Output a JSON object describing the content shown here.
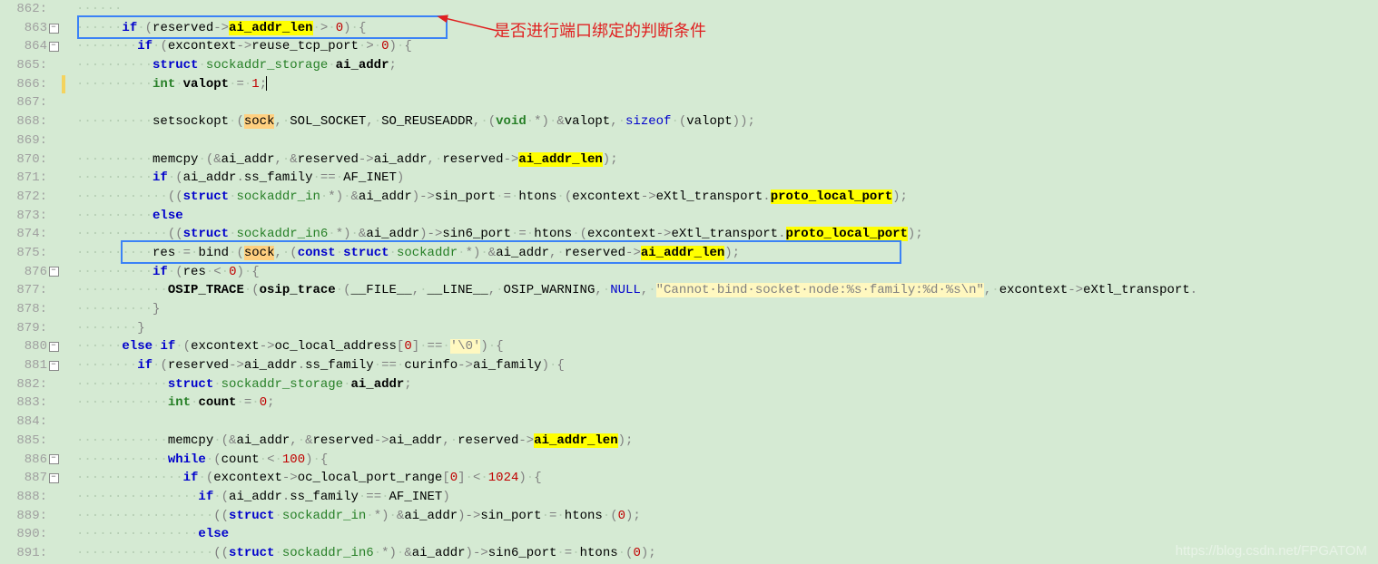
{
  "annotation": "是否进行端口绑定的判断条件",
  "watermark": "https://blog.csdn.net/FPGATOM",
  "lines": [
    {
      "n": "862:",
      "fold": false,
      "chg": false,
      "html": "<span class='ws'>······</span>"
    },
    {
      "n": "863",
      "fold": true,
      "chg": false,
      "html": "<span class='ws'>······</span><span class='kw'>if</span><span class='ws'>·</span><span class='op'>(</span>reserved<span class='op'>-&gt;</span><span class='id hl-y'>ai_addr_len</span><span class='ws'>·</span><span class='op'>&gt;</span><span class='ws'>·</span><span class='num'>0</span><span class='op'>)</span><span class='ws'>·</span><span class='op'>{</span>"
    },
    {
      "n": "864",
      "fold": true,
      "chg": false,
      "html": "<span class='ws'>········</span><span class='kw'>if</span><span class='ws'>·</span><span class='op'>(</span>excontext<span class='op'>-&gt;</span>reuse_tcp_port<span class='ws'>·</span><span class='op'>&gt;</span><span class='ws'>·</span><span class='num'>0</span><span class='op'>)</span><span class='ws'>·</span><span class='op'>{</span>"
    },
    {
      "n": "865:",
      "fold": false,
      "chg": false,
      "html": "<span class='ws'>··········</span><span class='kw'>struct</span><span class='ws'>·</span><span class='type-nb'>sockaddr_storage</span><span class='ws'>·</span><span class='id'>ai_addr</span><span class='op'>;</span>"
    },
    {
      "n": "866:",
      "fold": false,
      "chg": true,
      "html": "<span class='ws'>··········</span><span class='type'>int</span><span class='ws'>·</span><span class='id'>valopt</span><span class='ws'>·</span><span class='op'>=</span><span class='ws'>·</span><span class='num'>1</span><span class='op'>;</span><span class='caret'></span>"
    },
    {
      "n": "867:",
      "fold": false,
      "chg": false,
      "html": ""
    },
    {
      "n": "868:",
      "fold": false,
      "chg": false,
      "html": "<span class='ws'>··········</span>setsockopt<span class='ws'>·</span><span class='op'>(</span><span class='hl-o'>sock</span><span class='op'>,</span><span class='ws'>·</span>SOL_SOCKET<span class='op'>,</span><span class='ws'>·</span>SO_REUSEADDR<span class='op'>,</span><span class='ws'>·</span><span class='op'>(</span><span class='type'>void</span><span class='ws'>·</span><span class='op'>*)</span><span class='ws'>·</span><span class='op'>&amp;</span>valopt<span class='op'>,</span><span class='ws'>·</span><span class='kw-nb'>sizeof</span><span class='ws'>·</span><span class='op'>(</span>valopt<span class='op'>));</span>"
    },
    {
      "n": "869:",
      "fold": false,
      "chg": false,
      "html": ""
    },
    {
      "n": "870:",
      "fold": false,
      "chg": false,
      "html": "<span class='ws'>··········</span>memcpy<span class='ws'>·</span><span class='op'>(&amp;</span>ai_addr<span class='op'>,</span><span class='ws'>·</span><span class='op'>&amp;</span>reserved<span class='op'>-&gt;</span>ai_addr<span class='op'>,</span><span class='ws'>·</span>reserved<span class='op'>-&gt;</span><span class='id hl-y'>ai_addr_len</span><span class='op'>);</span>"
    },
    {
      "n": "871:",
      "fold": false,
      "chg": false,
      "html": "<span class='ws'>··········</span><span class='kw'>if</span><span class='ws'>·</span><span class='op'>(</span>ai_addr<span class='op'>.</span>ss_family<span class='ws'>·</span><span class='op'>==</span><span class='ws'>·</span>AF_INET<span class='op'>)</span>"
    },
    {
      "n": "872:",
      "fold": false,
      "chg": false,
      "html": "<span class='ws'>············</span><span class='op'>((</span><span class='kw'>struct</span><span class='ws'>·</span><span class='type-nb'>sockaddr_in</span><span class='ws'>·</span><span class='op'>*)</span><span class='ws'>·</span><span class='op'>&amp;</span>ai_addr<span class='op'>)-&gt;</span>sin_port<span class='ws'>·</span><span class='op'>=</span><span class='ws'>·</span>htons<span class='ws'>·</span><span class='op'>(</span>excontext<span class='op'>-&gt;</span>eXtl_transport<span class='op'>.</span><span class='id hl-y'>proto_local_port</span><span class='op'>);</span>"
    },
    {
      "n": "873:",
      "fold": false,
      "chg": false,
      "html": "<span class='ws'>··········</span><span class='kw'>else</span>"
    },
    {
      "n": "874:",
      "fold": false,
      "chg": false,
      "html": "<span class='ws'>············</span><span class='op'>((</span><span class='kw'>struct</span><span class='ws'>·</span><span class='type-nb'>sockaddr_in6</span><span class='ws'>·</span><span class='op'>*)</span><span class='ws'>·</span><span class='op'>&amp;</span>ai_addr<span class='op'>)-&gt;</span>sin6_port<span class='ws'>·</span><span class='op'>=</span><span class='ws'>·</span>htons<span class='ws'>·</span><span class='op'>(</span>excontext<span class='op'>-&gt;</span>eXtl_transport<span class='op'>.</span><span class='id hl-y'>proto_local_port</span><span class='op'>);</span>"
    },
    {
      "n": "875:",
      "fold": false,
      "chg": false,
      "html": "<span class='ws'>··········</span>res<span class='ws'>·</span><span class='op'>=</span><span class='ws'>·</span>bind<span class='ws'>·</span><span class='op'>(</span><span class='hl-o'>sock</span><span class='op'>,</span><span class='ws'>·</span><span class='op'>(</span><span class='kw'>const</span><span class='ws'>·</span><span class='kw'>struct</span><span class='ws'>·</span><span class='type-nb'>sockaddr</span><span class='ws'>·</span><span class='op'>*)</span><span class='ws'>·</span><span class='op'>&amp;</span>ai_addr<span class='op'>,</span><span class='ws'>·</span>reserved<span class='op'>-&gt;</span><span class='id hl-y'>ai_addr_len</span><span class='op'>);</span>"
    },
    {
      "n": "876",
      "fold": true,
      "chg": false,
      "html": "<span class='ws'>··········</span><span class='kw'>if</span><span class='ws'>·</span><span class='op'>(</span>res<span class='ws'>·</span><span class='op'>&lt;</span><span class='ws'>·</span><span class='num'>0</span><span class='op'>)</span><span class='ws'>·</span><span class='op'>{</span>"
    },
    {
      "n": "877:",
      "fold": false,
      "chg": false,
      "html": "<span class='ws'>············</span><span class='id'>OSIP_TRACE</span><span class='ws'>·</span><span class='op'>(</span><span class='id'>osip_trace</span><span class='ws'>·</span><span class='op'>(</span>__FILE__<span class='op'>,</span><span class='ws'>·</span>__LINE__<span class='op'>,</span><span class='ws'>·</span>OSIP_WARNING<span class='op'>,</span><span class='ws'>·</span><span class='kw-nb'>NULL</span><span class='op'>,</span><span class='ws'>·</span><span class='str'>\"Cannot·bind·socket·node:%s·family:%d·%s\\n\"</span><span class='op'>,</span><span class='ws'>·</span>excontext<span class='op'>-&gt;</span>eXtl_transport<span class='op'>.</span>"
    },
    {
      "n": "878:",
      "fold": false,
      "chg": false,
      "html": "<span class='ws'>··········</span><span class='op'>}</span>"
    },
    {
      "n": "879:",
      "fold": false,
      "chg": false,
      "html": "<span class='ws'>········</span><span class='op'>}</span>"
    },
    {
      "n": "880",
      "fold": true,
      "chg": false,
      "html": "<span class='ws'>······</span><span class='kw'>else</span><span class='ws'>·</span><span class='kw'>if</span><span class='ws'>·</span><span class='op'>(</span>excontext<span class='op'>-&gt;</span>oc_local_address<span class='op'>[</span><span class='num'>0</span><span class='op'>]</span><span class='ws'>·</span><span class='op'>==</span><span class='ws'>·</span><span class='str'>'\\0'</span><span class='op'>)</span><span class='ws'>·</span><span class='op'>{</span>"
    },
    {
      "n": "881",
      "fold": true,
      "chg": false,
      "html": "<span class='ws'>········</span><span class='kw'>if</span><span class='ws'>·</span><span class='op'>(</span>reserved<span class='op'>-&gt;</span>ai_addr<span class='op'>.</span>ss_family<span class='ws'>·</span><span class='op'>==</span><span class='ws'>·</span>curinfo<span class='op'>-&gt;</span>ai_family<span class='op'>)</span><span class='ws'>·</span><span class='op'>{</span>"
    },
    {
      "n": "882:",
      "fold": false,
      "chg": false,
      "html": "<span class='ws'>············</span><span class='kw'>struct</span><span class='ws'>·</span><span class='type-nb'>sockaddr_storage</span><span class='ws'>·</span><span class='id'>ai_addr</span><span class='op'>;</span>"
    },
    {
      "n": "883:",
      "fold": false,
      "chg": false,
      "html": "<span class='ws'>············</span><span class='type'>int</span><span class='ws'>·</span><span class='id'>count</span><span class='ws'>·</span><span class='op'>=</span><span class='ws'>·</span><span class='num'>0</span><span class='op'>;</span>"
    },
    {
      "n": "884:",
      "fold": false,
      "chg": false,
      "html": ""
    },
    {
      "n": "885:",
      "fold": false,
      "chg": false,
      "html": "<span class='ws'>············</span>memcpy<span class='ws'>·</span><span class='op'>(&amp;</span>ai_addr<span class='op'>,</span><span class='ws'>·</span><span class='op'>&amp;</span>reserved<span class='op'>-&gt;</span>ai_addr<span class='op'>,</span><span class='ws'>·</span>reserved<span class='op'>-&gt;</span><span class='id hl-y'>ai_addr_len</span><span class='op'>);</span>"
    },
    {
      "n": "886",
      "fold": true,
      "chg": false,
      "html": "<span class='ws'>············</span><span class='kw'>while</span><span class='ws'>·</span><span class='op'>(</span>count<span class='ws'>·</span><span class='op'>&lt;</span><span class='ws'>·</span><span class='num'>100</span><span class='op'>)</span><span class='ws'>·</span><span class='op'>{</span>"
    },
    {
      "n": "887",
      "fold": true,
      "chg": false,
      "html": "<span class='ws'>··············</span><span class='kw'>if</span><span class='ws'>·</span><span class='op'>(</span>excontext<span class='op'>-&gt;</span>oc_local_port_range<span class='op'>[</span><span class='num'>0</span><span class='op'>]</span><span class='ws'>·</span><span class='op'>&lt;</span><span class='ws'>·</span><span class='num'>1024</span><span class='op'>)</span><span class='ws'>·</span><span class='op'>{</span>"
    },
    {
      "n": "888:",
      "fold": false,
      "chg": false,
      "html": "<span class='ws'>················</span><span class='kw'>if</span><span class='ws'>·</span><span class='op'>(</span>ai_addr<span class='op'>.</span>ss_family<span class='ws'>·</span><span class='op'>==</span><span class='ws'>·</span>AF_INET<span class='op'>)</span>"
    },
    {
      "n": "889:",
      "fold": false,
      "chg": false,
      "html": "<span class='ws'>··················</span><span class='op'>((</span><span class='kw'>struct</span><span class='ws'>·</span><span class='type-nb'>sockaddr_in</span><span class='ws'>·</span><span class='op'>*)</span><span class='ws'>·</span><span class='op'>&amp;</span>ai_addr<span class='op'>)-&gt;</span>sin_port<span class='ws'>·</span><span class='op'>=</span><span class='ws'>·</span>htons<span class='ws'>·</span><span class='op'>(</span><span class='num'>0</span><span class='op'>);</span>"
    },
    {
      "n": "890:",
      "fold": false,
      "chg": false,
      "html": "<span class='ws'>················</span><span class='kw'>else</span>"
    },
    {
      "n": "891:",
      "fold": false,
      "chg": false,
      "html": "<span class='ws'>··················</span><span class='op'>((</span><span class='kw'>struct</span><span class='ws'>·</span><span class='type-nb'>sockaddr_in6</span><span class='ws'>·</span><span class='op'>*)</span><span class='ws'>·</span><span class='op'>&amp;</span>ai_addr<span class='op'>)-&gt;</span>sin6_port<span class='ws'>·</span><span class='op'>=</span><span class='ws'>·</span>htons<span class='ws'>·</span><span class='op'>(</span><span class='num'>0</span><span class='op'>);</span>"
    }
  ]
}
